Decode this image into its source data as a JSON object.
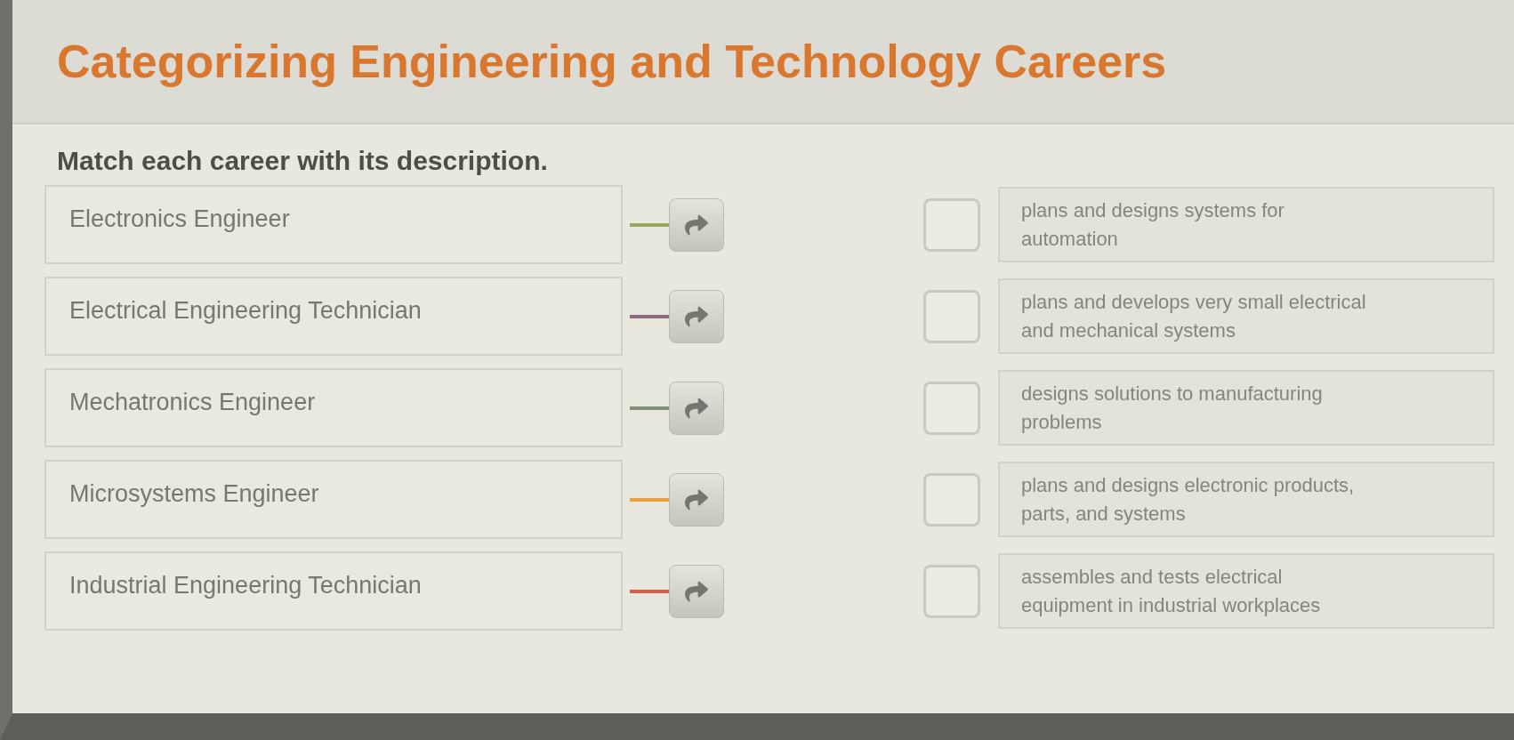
{
  "title": "Categorizing Engineering and Technology Careers",
  "instruction": "Match each career with its description.",
  "careers": [
    {
      "label": "Electronics Engineer",
      "color": "#9aa65a"
    },
    {
      "label": "Electrical Engineering Technician",
      "color": "#8c6b80"
    },
    {
      "label": "Mechatronics Engineer",
      "color": "#7f8f7a"
    },
    {
      "label": "Microsystems Engineer",
      "color": "#e8a040"
    },
    {
      "label": "Industrial Engineering Technician",
      "color": "#d8604a"
    }
  ],
  "descriptions": [
    {
      "text": "plans and designs systems for automation"
    },
    {
      "text": "plans and develops very small electrical and mechanical systems"
    },
    {
      "text": "designs solutions to manufacturing problems"
    },
    {
      "text": "plans and designs electronic products, parts, and systems"
    },
    {
      "text": "assembles and tests electrical equipment in industrial workplaces"
    }
  ]
}
